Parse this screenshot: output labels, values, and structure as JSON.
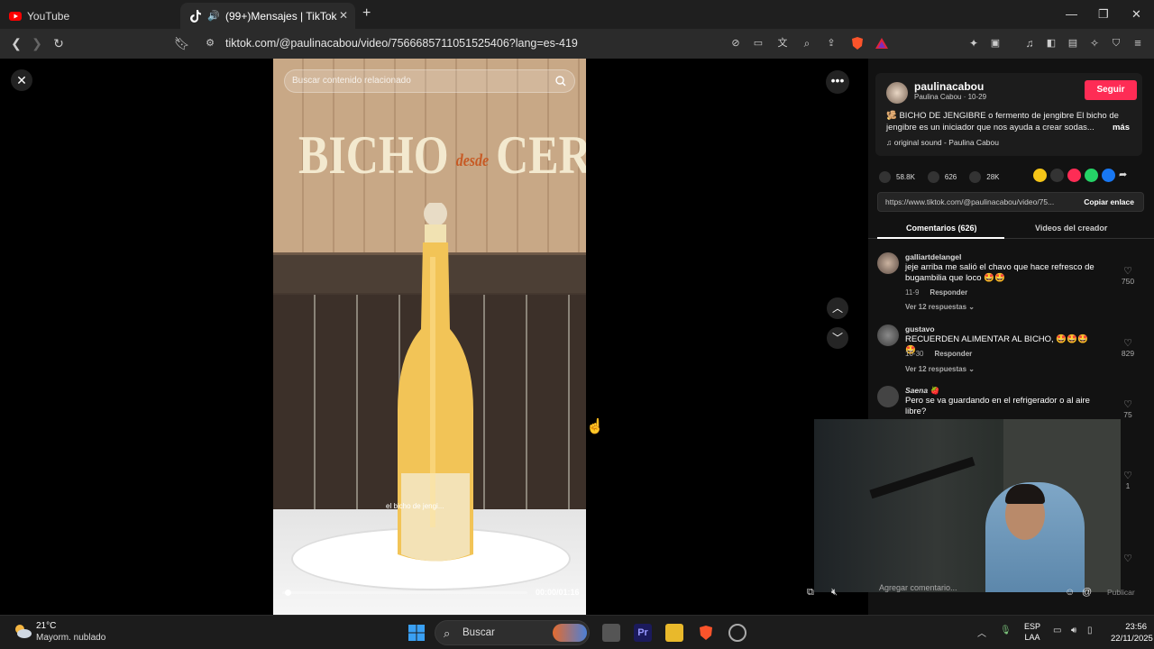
{
  "browser": {
    "tabs": [
      {
        "label": "YouTube",
        "icon": "youtube-icon",
        "active": false
      },
      {
        "label": "(99+)Mensajes | TikTok",
        "icon": "tiktok-icon",
        "active": true
      }
    ],
    "url": "tiktok.com/@paulinacabou/video/7566685711051525406?lang=es-419"
  },
  "video": {
    "search_placeholder": "Buscar contenido relacionado",
    "title_left": "BICHO",
    "title_mid": "desde",
    "title_right": "CERO",
    "caption": "el bicho de jengi...",
    "time": "00:00/01:16",
    "progress": 0.01
  },
  "sidebar": {
    "username": "paulinacabou",
    "subtitle": "Paulina Cabou · 10-29",
    "follow_label": "Seguir",
    "description": "🫚 BICHO DE JENGIBRE o fermento de jengibre El bicho de jengibre es un iniciador que nos ayuda a crear sodas...",
    "more_label": "más",
    "sound": "♫  original sound - Paulina Cabou",
    "likes": "58.8K",
    "comments_count": "626",
    "saves": "28K",
    "link": "https://www.tiktok.com/@paulinacabou/video/75...",
    "copy_label": "Copiar enlace",
    "tab_comments": "Comentarios (626)",
    "tab_videos": "Videos del creador",
    "comments": [
      {
        "user": "galliartdelangel",
        "text": "jeje arriba me salió el chavo que hace refresco de bugambilia que loco 🤩🤩",
        "date": "11-9",
        "reply": "Responder",
        "replies": "Ver 12 respuestas ⌄",
        "likes": "750"
      },
      {
        "user": "gustavo",
        "text": "RECUERDEN ALIMENTAR AL BICHO, 🤩🤩🤩🤩",
        "date": "10-30",
        "reply": "Responder",
        "replies": "Ver 12 respuestas ⌄",
        "likes": "829"
      },
      {
        "user": "Saena 🍓",
        "text": "Pero se va guardando en el refrigerador o al aire libre?",
        "likes": "75"
      }
    ],
    "extra_likes": "1",
    "comment_placeholder": "Agregar comentario...",
    "publish_label": "Publicar"
  },
  "taskbar": {
    "temp": "21°C",
    "weather": "Mayorm. nublado",
    "search": "Buscar",
    "lang1": "ESP",
    "lang2": "LAA",
    "time": "23:56",
    "date": "22/11/2025"
  }
}
